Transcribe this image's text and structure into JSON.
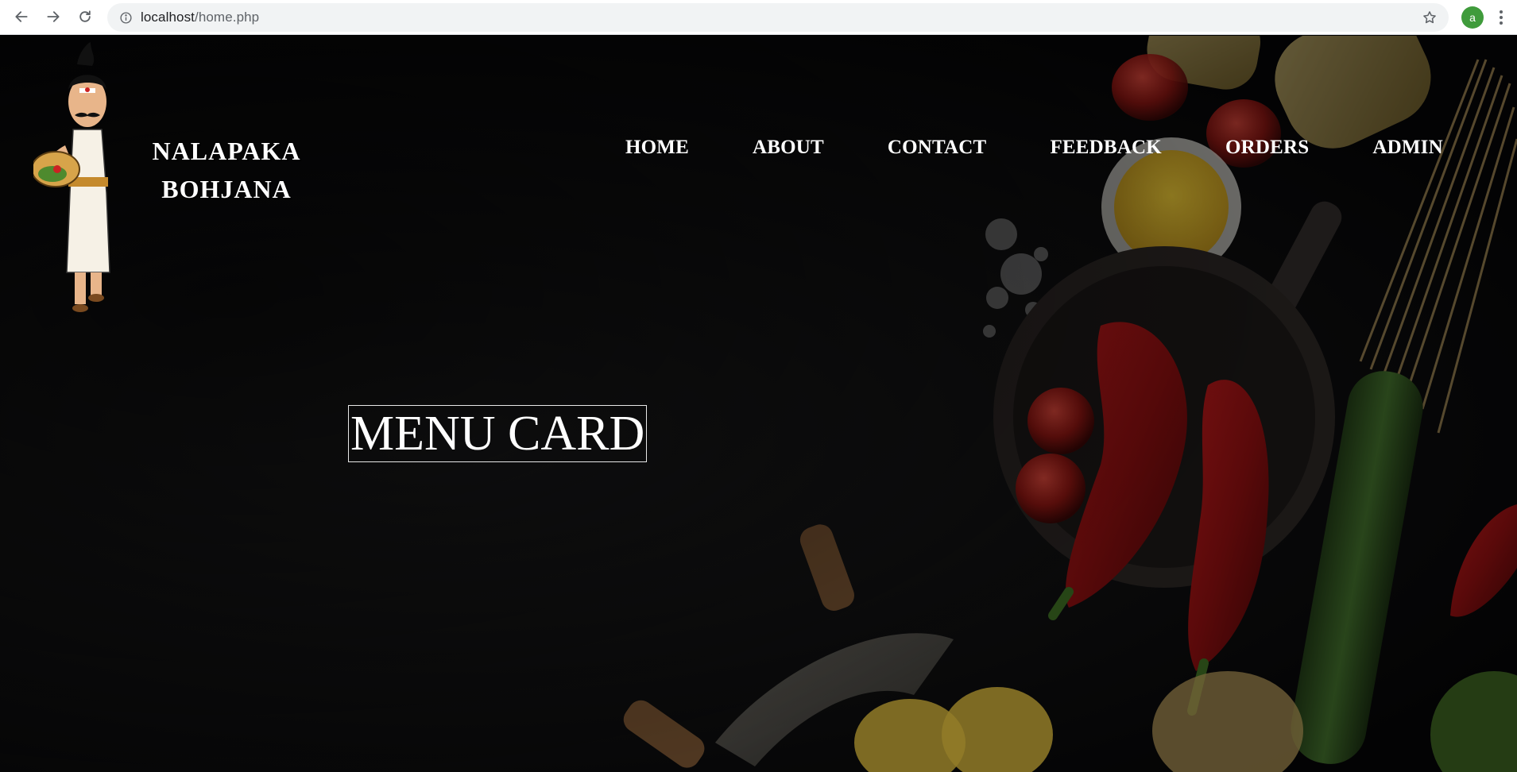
{
  "browser": {
    "url_host": "localhost",
    "url_path": "/home.php",
    "profile_initial": "a",
    "icons": {
      "back": "arrow-left-icon",
      "forward": "arrow-right-icon",
      "reload": "reload-icon",
      "site_info": "info-icon",
      "bookmark": "star-icon",
      "menu": "kebab-menu-icon"
    },
    "avatar_color": "#3f9b3b"
  },
  "site": {
    "logo_line1": "NALAPAKA",
    "logo_line2": "BOHJANA",
    "nav": [
      {
        "label": "HOME"
      },
      {
        "label": "ABOUT"
      },
      {
        "label": "CONTACT"
      },
      {
        "label": "FEEDBACK"
      },
      {
        "label": "ORDERS"
      },
      {
        "label": "ADMIN"
      }
    ],
    "hero_heading": "MENU CARD"
  }
}
